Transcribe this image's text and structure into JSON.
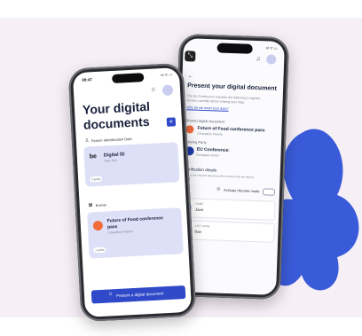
{
  "phone_left": {
    "time": "09:47",
    "status_icons": "signal-wifi-battery",
    "title_line1": "Your digital",
    "title_line2": "documents",
    "add_label": "+",
    "section_person": "Person Identification Data",
    "card_id": {
      "logo": "be",
      "title": "Digital ID",
      "subtitle": "Jane Doe",
      "badge": "4 active"
    },
    "section_events": "Events",
    "card_event": {
      "title_line1": "Future of Food conference",
      "title_line2": "pass",
      "subtitle": "Cineuation Panels",
      "badge": "1 active"
    },
    "present_button": "Present a digital document"
  },
  "phone_right": {
    "back_label": "←",
    "title": "Present your digital document",
    "intro": "The EU Conference requests the following to register.",
    "intro2": "Review carefully before sharing your data.",
    "link": "Why do we need your data?",
    "shared_label": "Shared digital document",
    "shared_title": "Future of Food conference pass",
    "shared_subtitle": "Cineuation Panels",
    "relying_label": "Relying Party",
    "relying_title": "EU Conference",
    "relying_subtitle": "European Union",
    "verification_label": "Verification details",
    "verification_text": "This is the required data that will be shared with the relying",
    "verification_text2": "party.",
    "discrete_label": "Activate discrete mode",
    "fields": [
      {
        "label": "NAME",
        "value": "Jane"
      },
      {
        "label": "LAST NAME",
        "value": "Doe"
      }
    ]
  },
  "colors": {
    "accent": "#2f49c8",
    "card": "#dde0f7",
    "background": "#f6eff6",
    "blob": "#3a5bd9"
  }
}
